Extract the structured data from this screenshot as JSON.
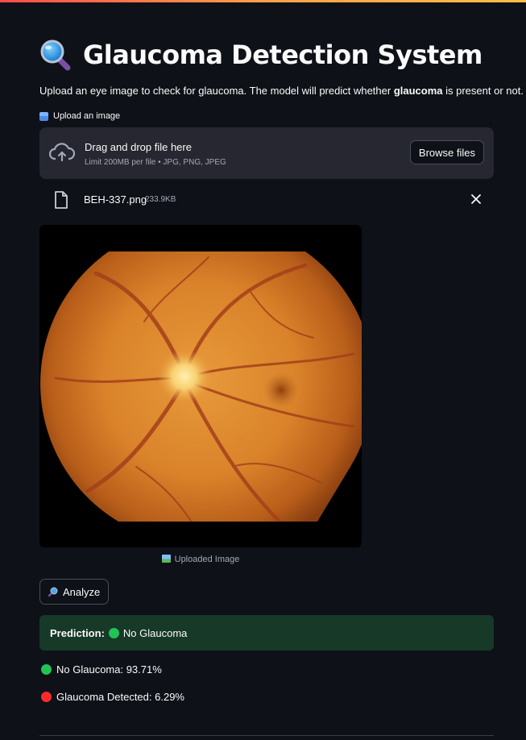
{
  "app": {
    "title": "Glaucoma Detection System",
    "title_icon": "magnifier-icon",
    "subtitle_pre": "Upload an eye image to check for glaucoma. The model will predict whether ",
    "subtitle_bold": "glaucoma",
    "subtitle_post": " is present or not."
  },
  "uploader": {
    "label": "Upload an image",
    "label_icon": "box-icon",
    "dropzone_title": "Drag and drop file here",
    "dropzone_limit": "Limit 200MB per file • JPG, PNG, JPEG",
    "browse_label": "Browse files",
    "file": {
      "name": "BEH-337.png",
      "size": "233.9KB"
    }
  },
  "image": {
    "caption": "Uploaded Image",
    "caption_icon": "picture-icon"
  },
  "analyze": {
    "label": "Analyze",
    "icon": "magnifier-icon"
  },
  "prediction": {
    "label": "Prediction:",
    "value": "No Glaucoma",
    "color": "#21c354",
    "background": "#173928"
  },
  "probabilities": [
    {
      "text": "No Glaucoma: 93.71%",
      "color": "#21c354"
    },
    {
      "text": "Glaucoma Detected: 6.29%",
      "color": "#ff2b2b"
    }
  ],
  "theme": {
    "background": "#0e1117",
    "panel": "#262730",
    "text": "#fafafa",
    "muted": "#a3a8b8"
  }
}
